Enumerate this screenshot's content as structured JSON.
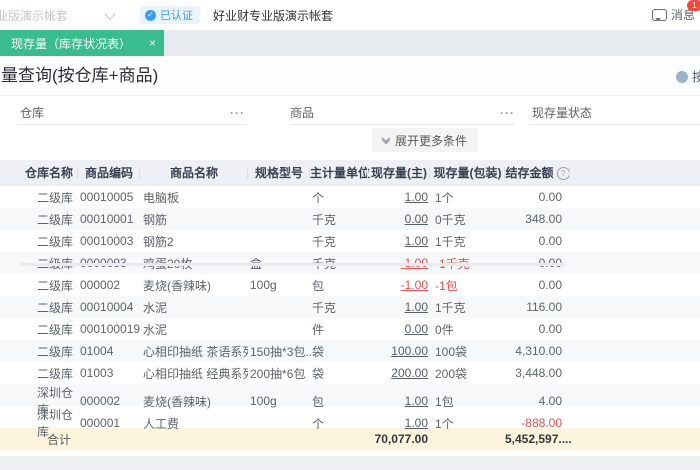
{
  "colors": {
    "accent_green": "#3ABD8E",
    "badge_blue": "#3D9AF0",
    "negative_red": "#E25250",
    "footer_bg": "#FCF4DD",
    "header_bg": "#EEF0F5"
  },
  "topbar": {
    "account_label": "业版演示帐套",
    "verified_icon_glyph": "✓",
    "verified_label": "已认证",
    "company_name": "好业财专业版演示帐套",
    "messages_label": "消息",
    "messages_count": "1"
  },
  "tabbar": {
    "active_tab": "现存量（库存状况表）",
    "close_glyph": "×"
  },
  "page": {
    "title": "量查询(按仓库+商品)",
    "corner_link": "按模"
  },
  "filters": {
    "fields": [
      {
        "label": "仓库",
        "more_glyph": "···"
      },
      {
        "label": "商品",
        "more_glyph": "···"
      },
      {
        "label": "现存量状态",
        "more_glyph": ""
      }
    ],
    "expand_label": "展开更多条件"
  },
  "table": {
    "headers": [
      "仓库名称",
      "商品编码",
      "商品名称",
      "规格型号",
      "主计量单位",
      "现存量(主)",
      "现存量(包装)",
      "结存金额"
    ],
    "amount_help_glyph": "?",
    "rows": [
      {
        "warehouse": "二级库",
        "code": "00010005",
        "name": "电脑板",
        "spec": "",
        "unit": "个",
        "qty": "1.00",
        "pkg": "1个",
        "amount": "0.00"
      },
      {
        "warehouse": "二级库",
        "code": "00010001",
        "name": "钢筋",
        "spec": "",
        "unit": "千克",
        "qty": "0.00",
        "pkg": "0千克",
        "amount": "348.00"
      },
      {
        "warehouse": "二级库",
        "code": "00010003",
        "name": "钢筋2",
        "spec": "",
        "unit": "千克",
        "qty": "1.00",
        "pkg": "1千克",
        "amount": "0.00"
      },
      {
        "warehouse": "二级库",
        "code": "0000093",
        "name": "鸡蛋20枚",
        "spec": "盒",
        "unit": "千克",
        "qty": "-1.00",
        "pkg": "-1千克",
        "amount": "0.00"
      },
      {
        "warehouse": "二级库",
        "code": "000002",
        "name": "麦烧(香辣味)",
        "spec": "100g",
        "unit": "包",
        "qty": "-1.00",
        "pkg": "-1包",
        "amount": "0.00"
      },
      {
        "warehouse": "二级库",
        "code": "00010004",
        "name": "水泥",
        "spec": "",
        "unit": "千克",
        "qty": "1.00",
        "pkg": "1千克",
        "amount": "116.00"
      },
      {
        "warehouse": "二级库",
        "code": "000100019",
        "name": "水泥",
        "spec": "",
        "unit": "件",
        "qty": "0.00",
        "pkg": "0件",
        "amount": "0.00"
      },
      {
        "warehouse": "二级库",
        "code": "01004",
        "name": "心相印抽纸 茶语系列 ...",
        "spec": "150抽*3包...",
        "unit": "袋",
        "qty": "100.00",
        "pkg": "100袋",
        "amount": "4,310.00"
      },
      {
        "warehouse": "二级库",
        "code": "01003",
        "name": "心相印抽纸 经典系列",
        "spec": "200抽*6包",
        "unit": "袋",
        "qty": "200.00",
        "pkg": "200袋",
        "amount": "3,448.00"
      },
      {
        "warehouse": "深圳仓库",
        "code": "000002",
        "name": "麦烧(香辣味)",
        "spec": "100g",
        "unit": "包",
        "qty": "1.00",
        "pkg": "1包",
        "amount": "4.00"
      },
      {
        "warehouse": "深圳仓库",
        "code": "000001",
        "name": "人工费",
        "spec": "",
        "unit": "个",
        "qty": "1.00",
        "pkg": "1个",
        "amount": "-888.00"
      }
    ],
    "footer": {
      "label": "合计",
      "qty_total": "70,077.00",
      "amount_total": "5,452,597...."
    }
  }
}
